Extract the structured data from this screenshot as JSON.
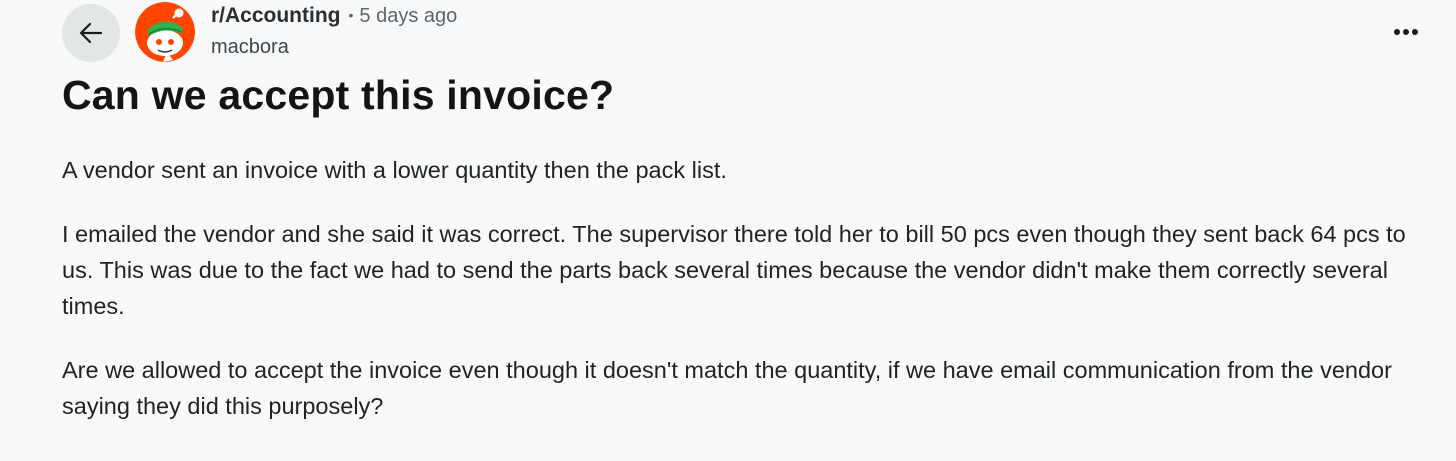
{
  "post": {
    "subreddit": "r/Accounting",
    "separator": "•",
    "time_ago": "5 days ago",
    "author": "macbora",
    "title": "Can we accept this invoice?",
    "paragraphs": [
      "A vendor sent an invoice with a lower quantity then the pack list.",
      "I emailed the vendor and she said it was correct. The supervisor there told her to bill 50 pcs even though they sent back 64 pcs to us. This was due to the fact we had to send the parts back several times because the vendor didn't make them correctly several times.",
      "Are we allowed to accept the invoice even though it doesn't match the quantity, if we have email communication from the vendor saying they did this purposely?"
    ]
  },
  "icons": {
    "back": "back-arrow-icon",
    "avatar": "reddit-snoo-avatar",
    "more": "more-options-icon"
  },
  "colors": {
    "background": "#f8f9f8",
    "back_button_bg": "#e2e7e4",
    "avatar_orange": "#ff4500",
    "avatar_visor_green": "#2fb34a"
  }
}
